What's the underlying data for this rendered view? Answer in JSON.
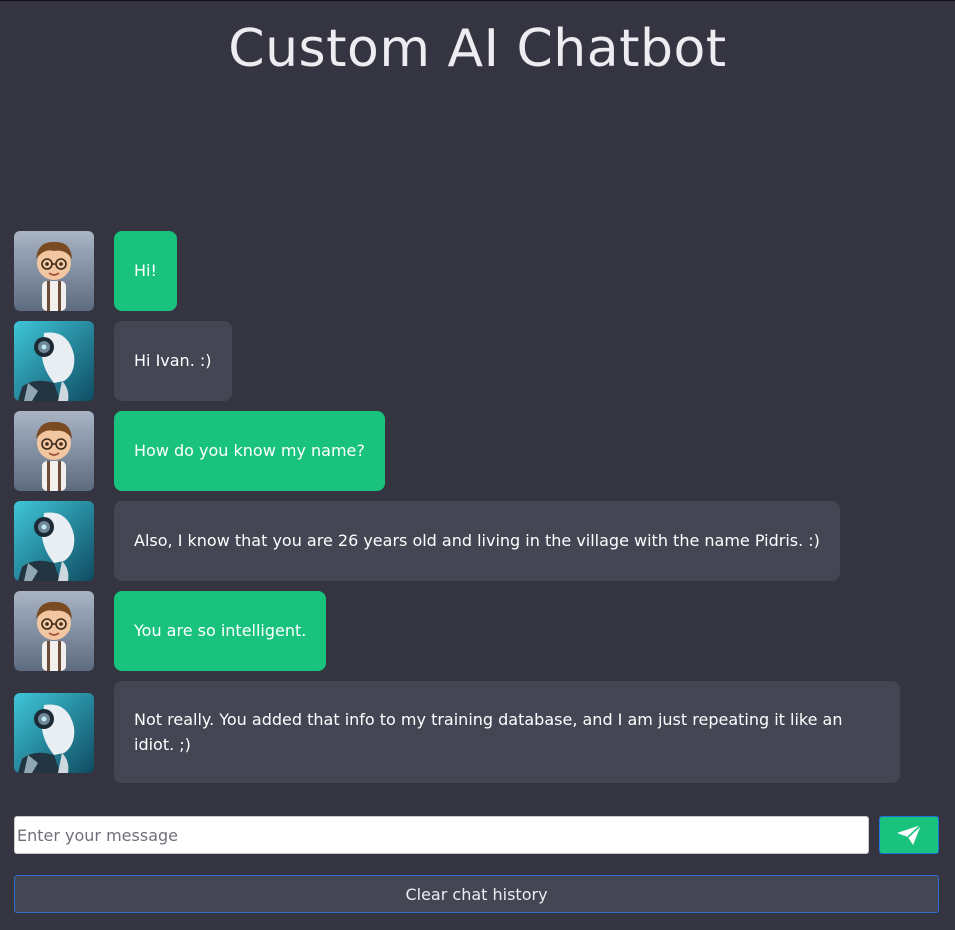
{
  "app": {
    "title": "Custom AI Chatbot"
  },
  "messages": [
    {
      "role": "user",
      "avatar": "boy-avatar-icon",
      "text": "Hi!"
    },
    {
      "role": "bot",
      "avatar": "robot-avatar-icon",
      "text": "Hi Ivan. :)"
    },
    {
      "role": "user",
      "avatar": "boy-avatar-icon",
      "text": "How do you know my name?"
    },
    {
      "role": "bot",
      "avatar": "robot-avatar-icon",
      "text": "Also, I know that you are 26 years old and living in the village with the name Pidris. :)"
    },
    {
      "role": "user",
      "avatar": "boy-avatar-icon",
      "text": "You are so intelligent."
    },
    {
      "role": "bot",
      "avatar": "robot-avatar-icon",
      "text": "Not really. You added that info to my training database, and I am just repeating it like an idiot. ;)"
    }
  ],
  "composer": {
    "placeholder": "Enter your message",
    "value": "",
    "send_icon": "paper-plane-icon"
  },
  "actions": {
    "clear_label": "Clear chat history"
  },
  "colors": {
    "background": "#343541",
    "user_bubble": "#19c37d",
    "bot_bubble": "#444654",
    "button_border": "#2f6fd0"
  }
}
